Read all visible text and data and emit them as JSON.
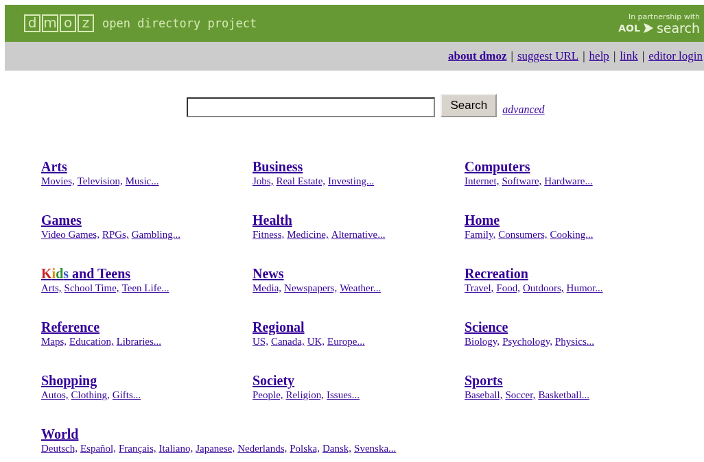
{
  "header": {
    "logo_letters": [
      "d",
      "m",
      "o",
      "z"
    ],
    "tagline": "open directory project",
    "partner_caption": "In partnership with",
    "partner_brand": "AOL",
    "partner_word": "search"
  },
  "nav": [
    {
      "kind": "link",
      "text": "about dmoz",
      "bold": true
    },
    {
      "kind": "separator",
      "text": "|"
    },
    {
      "kind": "link",
      "text": "suggest URL",
      "bold": false
    },
    {
      "kind": "separator",
      "text": "|"
    },
    {
      "kind": "link",
      "text": "help",
      "bold": false
    },
    {
      "kind": "separator",
      "text": "|"
    },
    {
      "kind": "link",
      "text": "link",
      "bold": false
    },
    {
      "kind": "separator",
      "text": "|"
    },
    {
      "kind": "link",
      "text": "editor login",
      "bold": false
    }
  ],
  "search": {
    "button": "Search",
    "advanced": "advanced"
  },
  "categories": [
    {
      "title": [
        {
          "text": "Arts"
        }
      ],
      "subs": [
        "Movies,",
        "Television,",
        "Music..."
      ]
    },
    {
      "title": [
        {
          "text": "Business"
        }
      ],
      "subs": [
        "Jobs,",
        "Real Estate,",
        "Investing..."
      ]
    },
    {
      "title": [
        {
          "text": "Computers"
        }
      ],
      "subs": [
        "Internet,",
        "Software,",
        "Hardware..."
      ]
    },
    {
      "title": [
        {
          "text": "Games"
        }
      ],
      "subs": [
        "Video Games,",
        "RPGs,",
        "Gambling..."
      ]
    },
    {
      "title": [
        {
          "text": "Health"
        }
      ],
      "subs": [
        "Fitness,",
        "Medicine,",
        "Alternative..."
      ]
    },
    {
      "title": [
        {
          "text": "Home"
        }
      ],
      "subs": [
        "Family,",
        "Consumers,",
        "Cooking..."
      ]
    },
    {
      "title": [
        {
          "text": "K",
          "color": "#cc2222"
        },
        {
          "text": "i",
          "color": "#e08a00"
        },
        {
          "text": "d",
          "color": "#2f8f2f"
        },
        {
          "text": "s",
          "color": "#3355cc"
        },
        {
          "text": " and Teens"
        }
      ],
      "subs": [
        "Arts,",
        "School Time,",
        "Teen Life..."
      ]
    },
    {
      "title": [
        {
          "text": "News"
        }
      ],
      "subs": [
        "Media,",
        "Newspapers,",
        "Weather..."
      ]
    },
    {
      "title": [
        {
          "text": "Recreation"
        }
      ],
      "subs": [
        "Travel,",
        "Food,",
        "Outdoors,",
        "Humor..."
      ]
    },
    {
      "title": [
        {
          "text": "Reference"
        }
      ],
      "subs": [
        "Maps,",
        "Education,",
        "Libraries..."
      ]
    },
    {
      "title": [
        {
          "text": "Regional"
        }
      ],
      "subs": [
        "US,",
        "Canada,",
        "UK,",
        "Europe..."
      ]
    },
    {
      "title": [
        {
          "text": "Science"
        }
      ],
      "subs": [
        "Biology,",
        "Psychology,",
        "Physics..."
      ]
    },
    {
      "title": [
        {
          "text": "Shopping"
        }
      ],
      "subs": [
        "Autos,",
        "Clothing,",
        "Gifts..."
      ]
    },
    {
      "title": [
        {
          "text": "Society"
        }
      ],
      "subs": [
        "People,",
        "Religion,",
        "Issues..."
      ]
    },
    {
      "title": [
        {
          "text": "Sports"
        }
      ],
      "subs": [
        "Baseball,",
        "Soccer,",
        "Basketball..."
      ]
    },
    {
      "title": [
        {
          "text": "World"
        }
      ],
      "subs": [
        "Deutsch,",
        "Español,",
        "Français,",
        "Italiano,",
        "Japanese,",
        "Nederlands,",
        "Polska,",
        "Dansk,",
        "Svenska..."
      ]
    }
  ]
}
